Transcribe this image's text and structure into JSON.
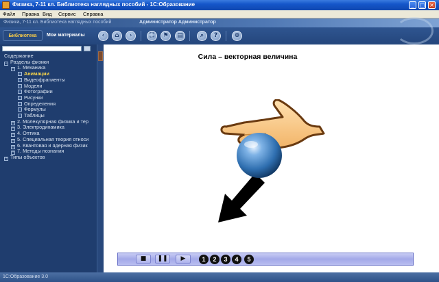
{
  "window": {
    "title": "Физика, 7-11 кл. Библиотека наглядных пособий - 1С:Образование",
    "controls": [
      "_",
      "□",
      "×"
    ]
  },
  "menu": [
    "Файл",
    "Правка",
    "Вид",
    "Сервис",
    "Справка"
  ],
  "header": {
    "title": "Физика, 7-11 кл. Библиотека наглядных пособий",
    "user": "Администратор Администратор"
  },
  "toolbar": {
    "tab_library": "Библиотека",
    "tab_my": "Мои материалы",
    "buttons": [
      "back-icon",
      "home-icon",
      "forward-icon",
      "fullscreen-icon",
      "bookmark-icon",
      "print-icon",
      "search-icon",
      "help-icon",
      "zoom-icon"
    ]
  },
  "sidebar": {
    "search_value": "",
    "tree": [
      {
        "label": "Содержание",
        "level": 0,
        "kind": "text"
      },
      {
        "label": "Разделы физики",
        "level": 0,
        "kind": "expanded"
      },
      {
        "label": "1. Механика",
        "level": 1,
        "kind": "expanded"
      },
      {
        "label": "Анимации",
        "level": 2,
        "kind": "leaf",
        "active": true
      },
      {
        "label": "Видеофрагменты",
        "level": 2,
        "kind": "leaf"
      },
      {
        "label": "Модели",
        "level": 2,
        "kind": "leaf"
      },
      {
        "label": "Фотографии",
        "level": 2,
        "kind": "leaf"
      },
      {
        "label": "Рисунки",
        "level": 2,
        "kind": "leaf"
      },
      {
        "label": "Определения",
        "level": 2,
        "kind": "leaf"
      },
      {
        "label": "Формулы",
        "level": 2,
        "kind": "leaf"
      },
      {
        "label": "Таблицы",
        "level": 2,
        "kind": "leaf"
      },
      {
        "label": "2. Молекулярная физика и тер",
        "level": 1,
        "kind": "collapsed"
      },
      {
        "label": "3. Электродинамика",
        "level": 1,
        "kind": "collapsed"
      },
      {
        "label": "4. Оптика",
        "level": 1,
        "kind": "collapsed"
      },
      {
        "label": "5. Специальная теория относи",
        "level": 1,
        "kind": "collapsed"
      },
      {
        "label": "6. Квантовая и ядерная физик",
        "level": 1,
        "kind": "collapsed"
      },
      {
        "label": "7. Методы познания",
        "level": 1,
        "kind": "collapsed"
      },
      {
        "label": "Типы объектов",
        "level": 0,
        "kind": "collapsed"
      }
    ]
  },
  "content": {
    "title": "Сила – векторная величина"
  },
  "player": {
    "buttons": [
      "stop-icon",
      "pause-icon",
      "play-icon"
    ],
    "glyphs": [
      "■",
      "❚❚",
      "▶"
    ],
    "steps": [
      "1",
      "2",
      "3",
      "4",
      "5"
    ]
  },
  "status": {
    "text": "1С:Образование 3.0"
  },
  "colors": {
    "hand": "#f2b468",
    "hand_outline": "#6a3a10",
    "ball": "#2f6fb0",
    "arrow": "#000000",
    "active_tree_item": "#f6d44a"
  }
}
